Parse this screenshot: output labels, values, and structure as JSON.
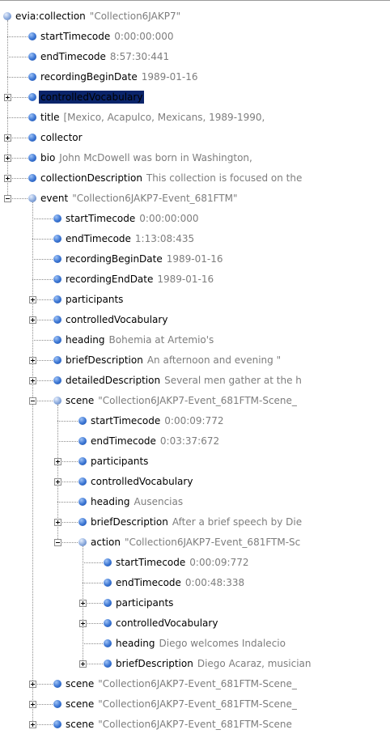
{
  "tree": {
    "nodes": [
      {
        "key": "evia:collection",
        "value": "\"Collection6JAKP7\"",
        "depth": 0,
        "expander": "none",
        "open": true
      },
      {
        "key": "startTimecode",
        "value": "0:00:00:000",
        "depth": 1,
        "expander": "none"
      },
      {
        "key": "endTimecode",
        "value": "8:57:30:441",
        "depth": 1,
        "expander": "none"
      },
      {
        "key": "recordingBeginDate",
        "value": "1989-01-16",
        "depth": 1,
        "expander": "none"
      },
      {
        "key": "controlledVocabulary",
        "value": "",
        "depth": 1,
        "expander": "plus",
        "selected": true
      },
      {
        "key": "title",
        "value": "[Mexico, Acapulco, Mexicans, 1989-1990,",
        "depth": 1,
        "expander": "none"
      },
      {
        "key": "collector",
        "value": "",
        "depth": 1,
        "expander": "plus"
      },
      {
        "key": "bio",
        "value": "John McDowell was born in Washington,",
        "depth": 1,
        "expander": "plus"
      },
      {
        "key": "collectionDescription",
        "value": "This collection is focused on the",
        "depth": 1,
        "expander": "plus"
      },
      {
        "key": "event",
        "value": "\"Collection6JAKP7-Event_681FTM\"",
        "depth": 1,
        "expander": "minus",
        "open": true
      },
      {
        "key": "startTimecode",
        "value": "0:00:00:000",
        "depth": 2,
        "expander": "none"
      },
      {
        "key": "endTimecode",
        "value": "1:13:08:435",
        "depth": 2,
        "expander": "none"
      },
      {
        "key": "recordingBeginDate",
        "value": "1989-01-16",
        "depth": 2,
        "expander": "none"
      },
      {
        "key": "recordingEndDate",
        "value": "1989-01-16",
        "depth": 2,
        "expander": "none"
      },
      {
        "key": "participants",
        "value": "",
        "depth": 2,
        "expander": "plus"
      },
      {
        "key": "controlledVocabulary",
        "value": "",
        "depth": 2,
        "expander": "plus"
      },
      {
        "key": "heading",
        "value": "Bohemia at Artemio's",
        "depth": 2,
        "expander": "none"
      },
      {
        "key": "briefDescription",
        "value": "An afternoon and evening \"",
        "depth": 2,
        "expander": "plus"
      },
      {
        "key": "detailedDescription",
        "value": "Several men gather at the h",
        "depth": 2,
        "expander": "plus"
      },
      {
        "key": "scene",
        "value": "\"Collection6JAKP7-Event_681FTM-Scene_",
        "depth": 2,
        "expander": "minus",
        "open": true
      },
      {
        "key": "startTimecode",
        "value": "0:00:09:772",
        "depth": 3,
        "expander": "none"
      },
      {
        "key": "endTimecode",
        "value": "0:03:37:672",
        "depth": 3,
        "expander": "none"
      },
      {
        "key": "participants",
        "value": "",
        "depth": 3,
        "expander": "plus"
      },
      {
        "key": "controlledVocabulary",
        "value": "",
        "depth": 3,
        "expander": "plus"
      },
      {
        "key": "heading",
        "value": "Ausencias",
        "depth": 3,
        "expander": "none"
      },
      {
        "key": "briefDescription",
        "value": "After a brief speech by Die",
        "depth": 3,
        "expander": "plus"
      },
      {
        "key": "action",
        "value": "\"Collection6JAKP7-Event_681FTM-Sc",
        "depth": 3,
        "expander": "minus",
        "open": true
      },
      {
        "key": "startTimecode",
        "value": "0:00:09:772",
        "depth": 4,
        "expander": "none"
      },
      {
        "key": "endTimecode",
        "value": "0:00:48:338",
        "depth": 4,
        "expander": "none"
      },
      {
        "key": "participants",
        "value": "",
        "depth": 4,
        "expander": "plus"
      },
      {
        "key": "controlledVocabulary",
        "value": "",
        "depth": 4,
        "expander": "plus"
      },
      {
        "key": "heading",
        "value": "Diego welcomes Indalecio",
        "depth": 4,
        "expander": "none"
      },
      {
        "key": "briefDescription",
        "value": "Diego Acaraz, musician",
        "depth": 4,
        "expander": "plus"
      },
      {
        "key": "scene",
        "value": "\"Collection6JAKP7-Event_681FTM-Scene_",
        "depth": 2,
        "expander": "plus"
      },
      {
        "key": "scene",
        "value": "\"Collection6JAKP7-Event_681FTM-Scene_",
        "depth": 2,
        "expander": "plus"
      },
      {
        "key": "scene",
        "value": "\"Collection6JAKP7-Event_681FTM-Scene",
        "depth": 2,
        "expander": "plus"
      }
    ]
  }
}
